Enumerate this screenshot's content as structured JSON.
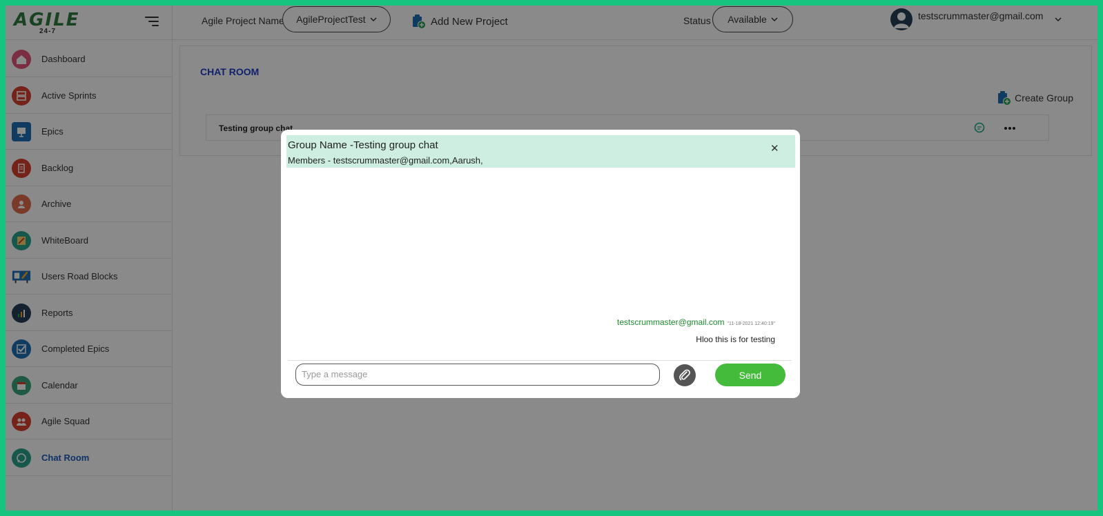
{
  "logo": {
    "main": "AGILE",
    "sub": "24-7"
  },
  "topbar": {
    "project_label": "Agile Project Name",
    "project_value": "AgileProjectTest",
    "add_project": "Add New Project",
    "status_label": "Status",
    "status_value": "Available",
    "user_email": "testscrummaster@gmail.com"
  },
  "sidebar": {
    "items": [
      {
        "label": "Dashboard",
        "icon": "home-icon",
        "color": "#e4557a"
      },
      {
        "label": "Active Sprints",
        "icon": "sprint-icon",
        "color": "#d8412f"
      },
      {
        "label": "Epics",
        "icon": "presentation-icon",
        "color": "#1e6fb6"
      },
      {
        "label": "Backlog",
        "icon": "backlog-icon",
        "color": "#d8412f"
      },
      {
        "label": "Archive",
        "icon": "archive-icon",
        "color": "#e06b4d"
      },
      {
        "label": "WhiteBoard",
        "icon": "whiteboard-icon",
        "color": "#2aa58c"
      },
      {
        "label": "Users Road Blocks",
        "icon": "roadblock-icon",
        "color": "#1e6fb6"
      },
      {
        "label": "Reports",
        "icon": "reports-icon",
        "color": "#263f59"
      },
      {
        "label": "Completed Epics",
        "icon": "checkbox-icon",
        "color": "#1e6fb6"
      },
      {
        "label": "Calendar",
        "icon": "calendar-icon",
        "color": "#3aa37c"
      },
      {
        "label": "Agile Squad",
        "icon": "squad-icon",
        "color": "#d8412f"
      },
      {
        "label": "Chat Room",
        "icon": "chat-icon",
        "color": "#2aa58c"
      }
    ]
  },
  "main": {
    "title": "CHAT ROOM",
    "create_group": "Create Group",
    "groups": [
      {
        "name": "Testing group chat"
      }
    ]
  },
  "modal": {
    "group_title": "Group Name -Testing group chat",
    "members": "Members - testscrummaster@gmail.com,Aarush,",
    "messages": [
      {
        "sender": "testscrummaster@gmail.com",
        "time": "\"11-18-2021 12:40:19\"",
        "text": "Hloo this is for testing"
      }
    ],
    "input_placeholder": "Type a message",
    "send_label": "Send"
  },
  "colors": {
    "accent_green": "#45bb3b",
    "header_bg": "#cdeee0",
    "frame": "#16c47f",
    "title_blue": "#1e3ec8"
  }
}
